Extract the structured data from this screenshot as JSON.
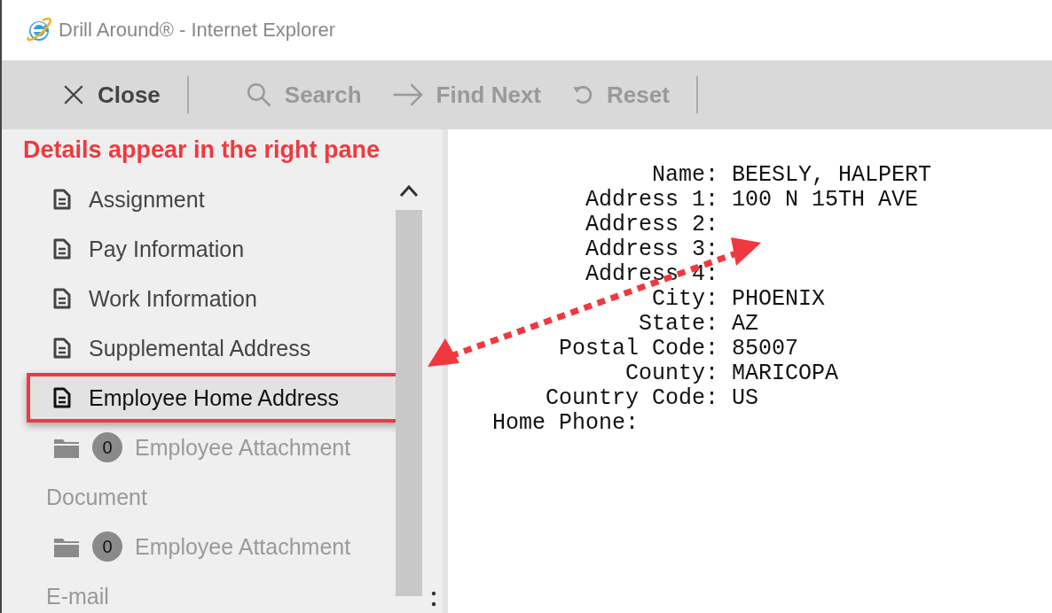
{
  "window": {
    "title": "Drill Around® - Internet Explorer"
  },
  "toolbar": [
    {
      "label": "Close",
      "disabled": false
    },
    {
      "label": "Search",
      "disabled": true
    },
    {
      "label": "Find Next",
      "disabled": true
    },
    {
      "label": "Reset",
      "disabled": true
    }
  ],
  "annotation": "Details appear in the right pane",
  "sidebar": {
    "items": [
      {
        "kind": "document",
        "label": "Assignment",
        "selected": false
      },
      {
        "kind": "document",
        "label": "Pay Information",
        "selected": false
      },
      {
        "kind": "document",
        "label": "Work Information",
        "selected": false
      },
      {
        "kind": "document",
        "label": "Supplemental Address",
        "selected": false
      },
      {
        "kind": "document",
        "label": "Employee Home Address",
        "selected": true
      },
      {
        "kind": "attachment",
        "label": "Employee Attachment",
        "count": "0"
      },
      {
        "kind": "section",
        "label": "Document"
      },
      {
        "kind": "attachment",
        "label": "Employee Attachment",
        "count": "0"
      },
      {
        "kind": "section",
        "label": "E-mail"
      }
    ]
  },
  "details": {
    "lines": [
      "            Name: BEESLY, HALPERT",
      "       Address 1: 100 N 15TH AVE",
      "       Address 2:",
      "       Address 3:",
      "       Address 4:",
      "            City: PHOENIX",
      "           State: AZ",
      "     Postal Code: 85007",
      "          County: MARICOPA",
      "    Country Code: US",
      "Home Phone:"
    ]
  }
}
